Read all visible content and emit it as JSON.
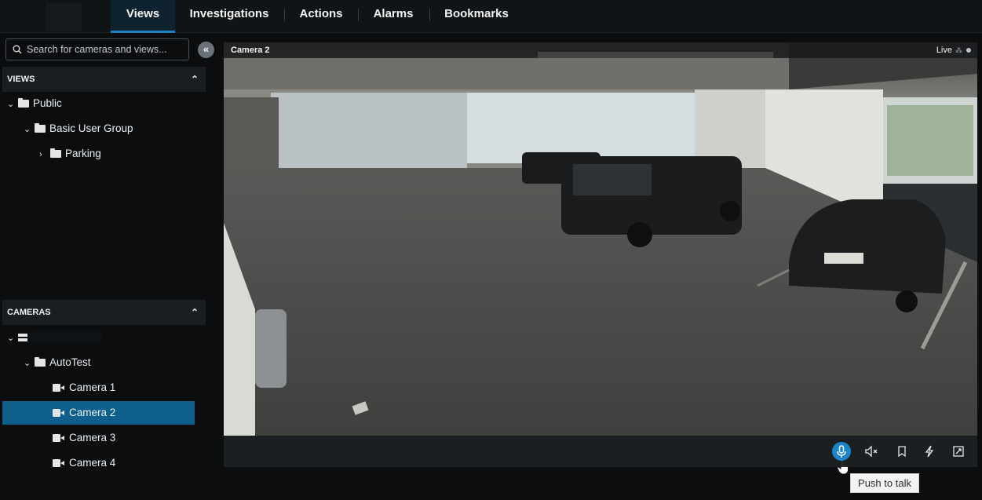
{
  "nav": {
    "tabs": [
      {
        "label": "Views",
        "active": true
      },
      {
        "label": "Investigations",
        "active": false
      },
      {
        "label": "Actions",
        "active": false
      },
      {
        "label": "Alarms",
        "active": false
      },
      {
        "label": "Bookmarks",
        "active": false
      }
    ]
  },
  "sidebar": {
    "search_placeholder": "Search for cameras and views...",
    "collapse_icon": "double-chevron-left-icon",
    "views_header": "VIEWS",
    "views_tree": [
      {
        "label": "Public",
        "icon": "folder-icon",
        "expanded": true
      },
      {
        "label": "Basic User Group",
        "icon": "folder-icon",
        "expanded": true
      },
      {
        "label": "Parking",
        "icon": "folder-icon",
        "expanded": false
      }
    ],
    "cameras_header": "CAMERAS",
    "cameras_tree": {
      "server_icon": "server-icon",
      "group": {
        "label": "AutoTest",
        "icon": "folder-icon",
        "expanded": true
      },
      "cameras": [
        {
          "label": "Camera 1",
          "selected": false
        },
        {
          "label": "Camera 2",
          "selected": true
        },
        {
          "label": "Camera 3",
          "selected": false
        },
        {
          "label": "Camera 4",
          "selected": false
        }
      ]
    }
  },
  "video": {
    "title": "Camera 2",
    "status": "Live",
    "toolbar_icons": [
      "microphone-icon",
      "speaker-muted-icon",
      "bookmark-icon",
      "lightning-icon",
      "fullscreen-icon"
    ],
    "tooltip": "Push to talk"
  },
  "colors": {
    "accent": "#1c84c6",
    "selected_row": "#0f5f8c",
    "background": "#0b0d0f"
  }
}
